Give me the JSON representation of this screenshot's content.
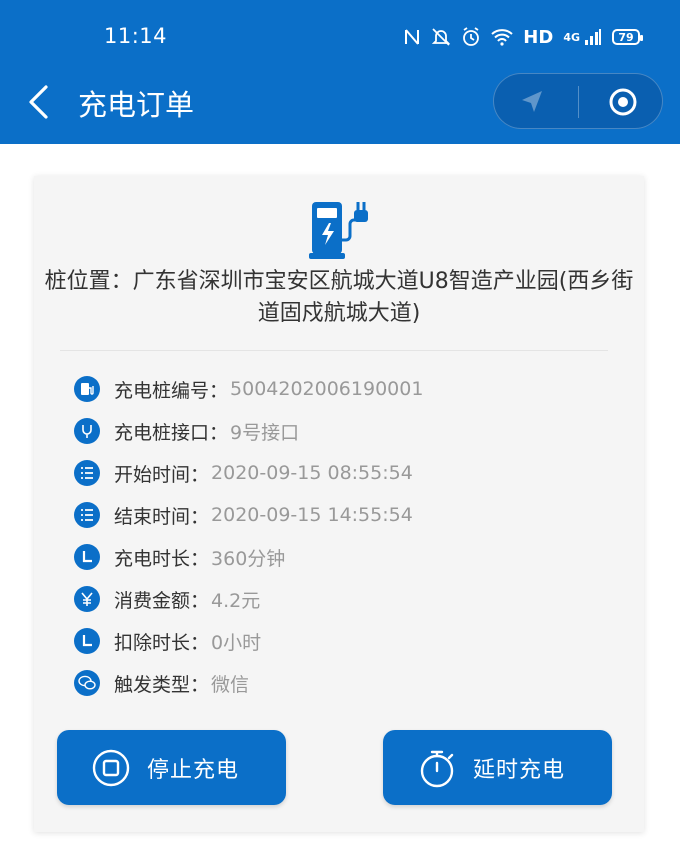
{
  "status_bar": {
    "time": "11:14",
    "hd": "HD",
    "signal": "4G",
    "battery": "79"
  },
  "header": {
    "title": "充电订单"
  },
  "station": {
    "address": "桩位置：广东省深圳市宝安区航城大道U8智造产业园(西乡街道固戍航城大道)"
  },
  "details": [
    {
      "label": "充电桩编号：",
      "value": "5004202006190001",
      "icon": "charger-icon"
    },
    {
      "label": "充电桩接口：",
      "value": "9号接口",
      "icon": "plug-icon"
    },
    {
      "label": "开始时间：",
      "value": "2020-09-15 08:55:54",
      "icon": "list-icon"
    },
    {
      "label": "结束时间：",
      "value": "2020-09-15 14:55:54",
      "icon": "list-icon"
    },
    {
      "label": "充电时长：",
      "value": "360分钟",
      "icon": "clock-icon"
    },
    {
      "label": "消费金额：",
      "value": "4.2元",
      "icon": "yuan-icon"
    },
    {
      "label": "扣除时长：",
      "value": "0小时",
      "icon": "clock-icon"
    },
    {
      "label": "触发类型：",
      "value": "微信",
      "icon": "wechat-icon"
    }
  ],
  "actions": {
    "stop_label": "停止充电",
    "delay_label": "延时充电"
  },
  "colors": {
    "primary": "#0b6fc8",
    "card_bg": "#f5f5f5",
    "value_text": "#999999"
  }
}
